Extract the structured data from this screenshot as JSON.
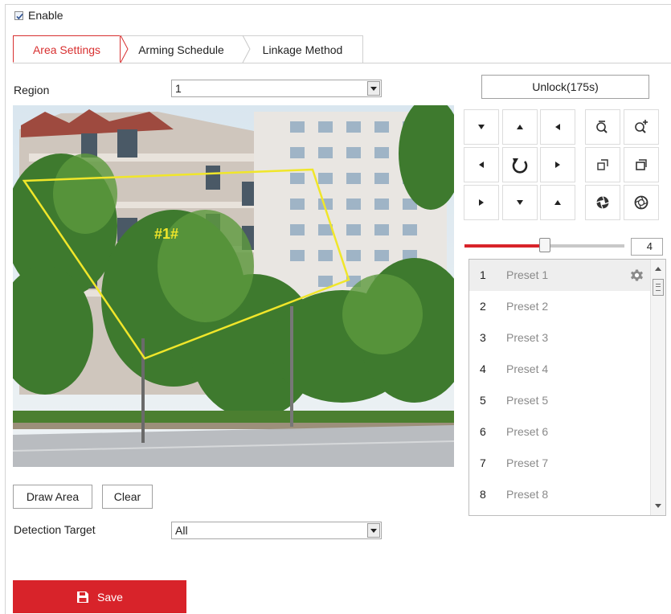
{
  "enable": {
    "label": "Enable",
    "checked": true
  },
  "tabs": [
    {
      "label": "Area Settings",
      "active": true
    },
    {
      "label": "Arming Schedule",
      "active": false
    },
    {
      "label": "Linkage Method",
      "active": false
    }
  ],
  "region": {
    "label": "Region",
    "value": "1"
  },
  "video": {
    "area_label": "#1#"
  },
  "unlock_button": "Unlock(175s)",
  "ptz": {
    "icons": [
      "pan-up-left-icon",
      "pan-up-icon",
      "pan-up-right-icon",
      "pan-left-icon",
      "auto-pan-icon",
      "pan-right-icon",
      "pan-down-left-icon",
      "pan-down-icon",
      "pan-down-right-icon",
      "zoom-out-icon",
      "zoom-in-icon",
      "focus-near-icon",
      "focus-far-icon",
      "iris-close-icon",
      "iris-open-icon"
    ],
    "speed": {
      "value": "4",
      "level": 0.5
    }
  },
  "presets": [
    {
      "num": "1",
      "name": "Preset 1"
    },
    {
      "num": "2",
      "name": "Preset 2"
    },
    {
      "num": "3",
      "name": "Preset 3"
    },
    {
      "num": "4",
      "name": "Preset 4"
    },
    {
      "num": "5",
      "name": "Preset 5"
    },
    {
      "num": "6",
      "name": "Preset 6"
    },
    {
      "num": "7",
      "name": "Preset 7"
    },
    {
      "num": "8",
      "name": "Preset 8"
    }
  ],
  "buttons": {
    "draw_area": "Draw Area",
    "clear": "Clear",
    "save": "Save"
  },
  "detection_target": {
    "label": "Detection Target",
    "value": "All"
  },
  "colors": {
    "accent": "#d8232a",
    "area_outline": "#f0e62a"
  }
}
